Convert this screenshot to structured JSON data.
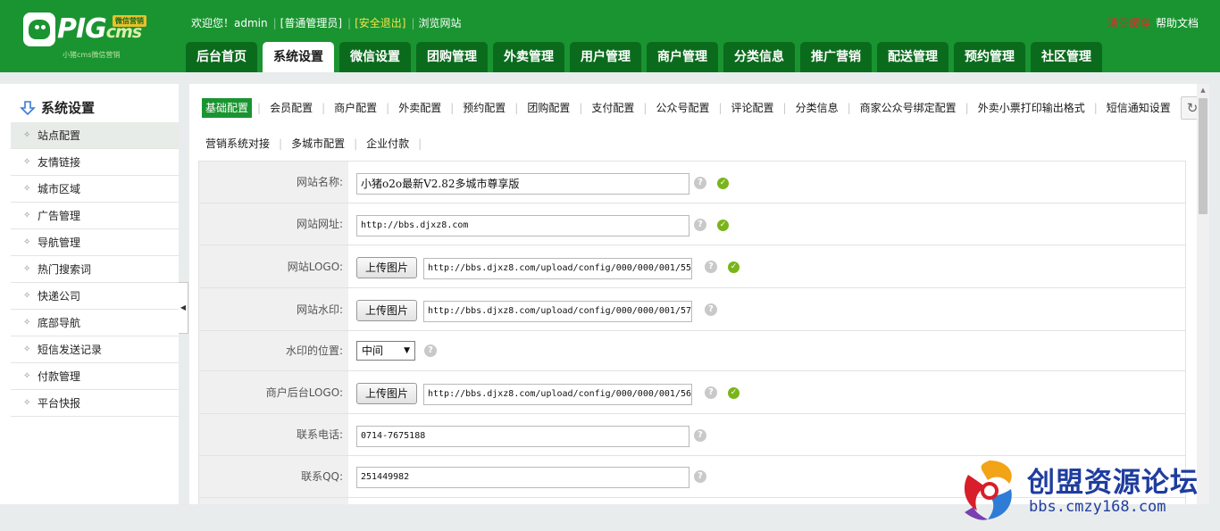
{
  "logo": {
    "brand": "PIG",
    "suffix": "cms",
    "tag": "微信营销",
    "url": "小猪cms微信营销"
  },
  "userbar": {
    "welcome": "欢迎您！admin",
    "role": "[普通管理员]",
    "logout": "[安全退出]",
    "browse": "浏览网站"
  },
  "topright": {
    "clear_cache": "清空缓存",
    "help": "帮助文档"
  },
  "colors": {
    "header_green": "#1a9431",
    "tab_dark": "#0b6b1d",
    "logout_yellow": "#f3e14b",
    "clear_red": "#e62727",
    "watermark_blue": "#1f3da0"
  },
  "nav": {
    "tabs": [
      {
        "label": "后台首页"
      },
      {
        "label": "系统设置"
      },
      {
        "label": "微信设置"
      },
      {
        "label": "团购管理"
      },
      {
        "label": "外卖管理"
      },
      {
        "label": "用户管理"
      },
      {
        "label": "商户管理"
      },
      {
        "label": "分类信息"
      },
      {
        "label": "推广营销"
      },
      {
        "label": "配送管理"
      },
      {
        "label": "预约管理"
      },
      {
        "label": "社区管理"
      }
    ],
    "active_index": 1
  },
  "sidebar": {
    "title": "系统设置",
    "items": [
      {
        "label": "站点配置"
      },
      {
        "label": "友情链接"
      },
      {
        "label": "城市区域"
      },
      {
        "label": "广告管理"
      },
      {
        "label": "导航管理"
      },
      {
        "label": "热门搜索词"
      },
      {
        "label": "快递公司"
      },
      {
        "label": "底部导航"
      },
      {
        "label": "短信发送记录"
      },
      {
        "label": "付款管理"
      },
      {
        "label": "平台快报"
      }
    ]
  },
  "subtabs": {
    "row1": [
      {
        "label": "基础配置"
      },
      {
        "label": "会员配置"
      },
      {
        "label": "商户配置"
      },
      {
        "label": "外卖配置"
      },
      {
        "label": "预约配置"
      },
      {
        "label": "团购配置"
      },
      {
        "label": "支付配置"
      },
      {
        "label": "公众号配置"
      },
      {
        "label": "评论配置"
      },
      {
        "label": "分类信息"
      },
      {
        "label": "商家公众号绑定配置"
      },
      {
        "label": "外卖小票打印输出格式"
      },
      {
        "label": "短信通知设置"
      }
    ],
    "row2": [
      {
        "label": "营销系统对接"
      },
      {
        "label": "多城市配置"
      },
      {
        "label": "企业付款"
      }
    ]
  },
  "form": {
    "site_name": {
      "label": "网站名称:",
      "value": "小猪o2o最新V2.82多城市尊享版"
    },
    "site_url": {
      "label": "网站网址:",
      "value": "http://bbs.djxz8.com"
    },
    "site_logo": {
      "label": "网站LOGO:",
      "button": "上传图片",
      "value": "http://bbs.djxz8.com/upload/config/000/000/001/55"
    },
    "site_watermark": {
      "label": "网站水印:",
      "button": "上传图片",
      "value": "http://bbs.djxz8.com/upload/config/000/000/001/57"
    },
    "watermark_position": {
      "label": "水印的位置:",
      "value": "中间"
    },
    "merchant_logo": {
      "label": "商户后台LOGO:",
      "button": "上传图片",
      "value": "http://bbs.djxz8.com/upload/config/000/000/001/56"
    },
    "phone": {
      "label": "联系电话:",
      "value": "0714-7675188"
    },
    "qq": {
      "label": "联系QQ:",
      "value": "251449982"
    }
  },
  "help_mark": "?",
  "ok_mark": "✓",
  "watermark": {
    "title": "创盟资源论坛",
    "url": "bbs.cmzy168.com"
  }
}
